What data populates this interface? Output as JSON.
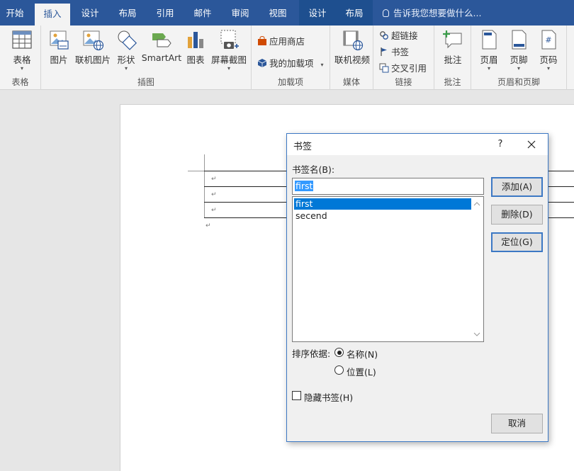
{
  "tabs": [
    {
      "label": "开始"
    },
    {
      "label": "插入"
    },
    {
      "label": "设计"
    },
    {
      "label": "布局"
    },
    {
      "label": "引用"
    },
    {
      "label": "邮件"
    },
    {
      "label": "审阅"
    },
    {
      "label": "视图"
    },
    {
      "label": "设计"
    },
    {
      "label": "布局"
    }
  ],
  "tellme": "告诉我您想要做什么...",
  "ribbon": {
    "table_group": {
      "label": "表格",
      "table_btn": "表格"
    },
    "illustrations": {
      "label": "插图",
      "picture": "图片",
      "online_picture": "联机图片",
      "shapes": "形状",
      "smartart": "SmartArt",
      "chart": "图表",
      "screenshot": "屏幕截图"
    },
    "addins": {
      "label": "加载项",
      "store": "应用商店",
      "my_addins": "我的加载项"
    },
    "media": {
      "label": "媒体",
      "online_video": "联机视频"
    },
    "links": {
      "label": "链接",
      "hyperlink": "超链接",
      "bookmark": "书签",
      "crossref": "交叉引用"
    },
    "comments": {
      "label": "批注",
      "comment": "批注"
    },
    "header_footer": {
      "label": "页眉和页脚",
      "header": "页眉",
      "footer": "页脚",
      "page_number": "页码"
    }
  },
  "dialog": {
    "title": "书签",
    "help": "?",
    "name_label": "书签名(B):",
    "name_value": "first",
    "items": [
      "first",
      "secend"
    ],
    "selected_index": 0,
    "buttons": {
      "add": "添加(A)",
      "delete": "删除(D)",
      "goto": "定位(G)",
      "cancel": "取消"
    },
    "sort_label": "排序依据:",
    "sort_options": {
      "name": "名称(N)",
      "location": "位置(L)"
    },
    "sort_selected": "name",
    "hidden_label": "隐藏书签(H)",
    "hidden_checked": false
  },
  "colors": {
    "ribbon_blue": "#2b579a",
    "selection": "#0078d7",
    "dialog_border": "#3c78c4"
  }
}
